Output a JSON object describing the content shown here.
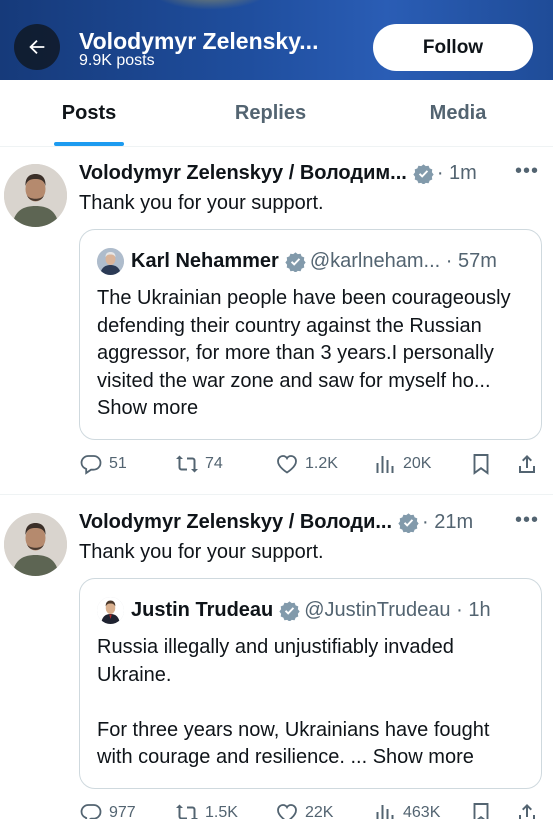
{
  "header": {
    "title": "Volodymyr Zelensky...",
    "subtitle": "9.9K posts",
    "follow_label": "Follow"
  },
  "tabs": [
    {
      "label": "Posts",
      "active": true
    },
    {
      "label": "Replies",
      "active": false
    },
    {
      "label": "Media",
      "active": false
    }
  ],
  "posts": [
    {
      "author": "Volodymyr Zelenskyy / Володим...",
      "time": "· 1m",
      "text": "Thank you for your support.",
      "quote": {
        "name": "Karl Nehammer",
        "handle": "@karlneham... · 57m",
        "body": "The Ukrainian people have been courageously defending their country against the Russian aggressor, for more than 3 years.I personally visited the war zone and saw for myself ho...",
        "show_more": "Show more"
      },
      "stats": {
        "replies": "51",
        "reposts": "74",
        "likes": "1.2K",
        "views": "20K"
      }
    },
    {
      "author": "Volodymyr Zelenskyy / Володи...",
      "time": "· 21m",
      "text": "Thank you for your support.",
      "quote": {
        "name": "Justin Trudeau",
        "handle": "@JustinTrudeau · 1h",
        "body": "Russia illegally and unjustifiably invaded Ukraine.\n\nFor three years now, Ukrainians have fought with courage and resilience. ...",
        "show_more": "Show more"
      },
      "stats": {
        "replies": "977",
        "reposts": "1.5K",
        "likes": "22K",
        "views": "463K"
      }
    }
  ],
  "colors": {
    "accent": "#1d9bf0",
    "verified": "#829aab",
    "header_bg": "#1f4e9e",
    "muted": "#536471"
  }
}
